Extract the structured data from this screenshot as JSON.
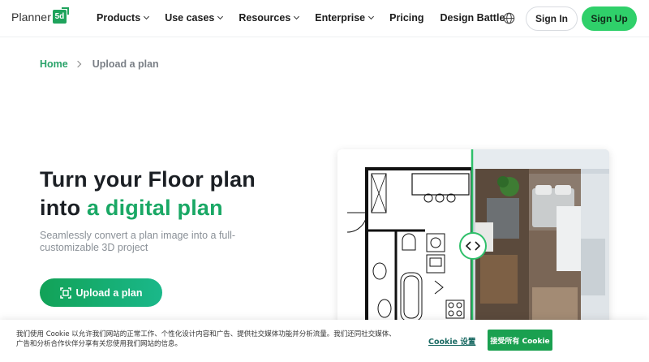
{
  "header": {
    "logo_text": "Planner",
    "logo_badge": "5d",
    "nav": [
      {
        "label": "Products",
        "has_dropdown": true
      },
      {
        "label": "Use cases",
        "has_dropdown": true
      },
      {
        "label": "Resources",
        "has_dropdown": true
      },
      {
        "label": "Enterprise",
        "has_dropdown": true
      },
      {
        "label": "Pricing",
        "has_dropdown": false
      },
      {
        "label": "Design Battle",
        "has_dropdown": false
      }
    ],
    "language_icon": "globe-icon",
    "sign_in": "Sign In",
    "sign_up": "Sign Up"
  },
  "breadcrumb": {
    "home": "Home",
    "current": "Upload a plan"
  },
  "hero": {
    "title_line1": "Turn your Floor plan",
    "title_line2_prefix": "into ",
    "title_line2_highlight": "a digital plan",
    "subtitle": "Seamlessly convert a plan image into a full-customizable 3D project",
    "upload_button": "Upload a plan"
  },
  "cookie": {
    "text": "我们使用 Cookie 以允许我们网站的正常工作、个性化设计内容和广告、提供社交媒体功能并分析流量。我们还同社交媒体、广告和分析合作伙伴分享有关您使用我们网站的信息。",
    "settings": "Cookie 设置",
    "accept": "接受所有 Cookie"
  },
  "colors": {
    "brand_green": "#1aa865",
    "signup_green": "#2fd06a",
    "accept_green": "#1aa050"
  }
}
